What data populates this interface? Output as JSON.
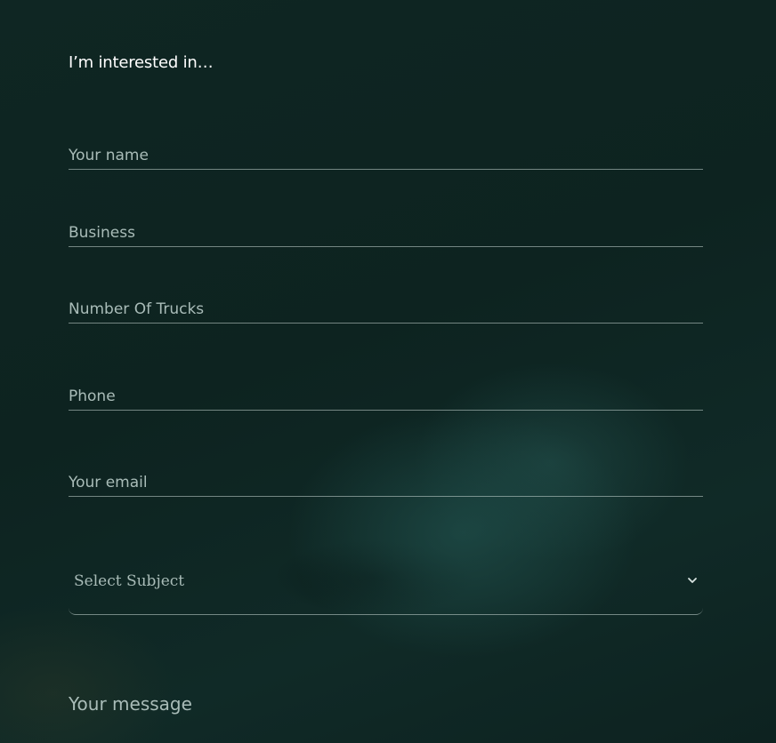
{
  "form": {
    "interest_label": "I’m interested in…",
    "fields": {
      "name": {
        "placeholder": "Your name"
      },
      "business": {
        "placeholder": "Business"
      },
      "trucks": {
        "placeholder": "Number Of Trucks"
      },
      "phone": {
        "placeholder": "Phone"
      },
      "email": {
        "placeholder": "Your email"
      }
    },
    "subject": {
      "selected": "Select Subject",
      "icon": "chevron-down-icon"
    },
    "message": {
      "placeholder": "Your message"
    }
  },
  "colors": {
    "background": "#0e2421",
    "text": "#ffffff",
    "placeholder": "#a9bcb8",
    "underline": "#c8d7d4"
  }
}
